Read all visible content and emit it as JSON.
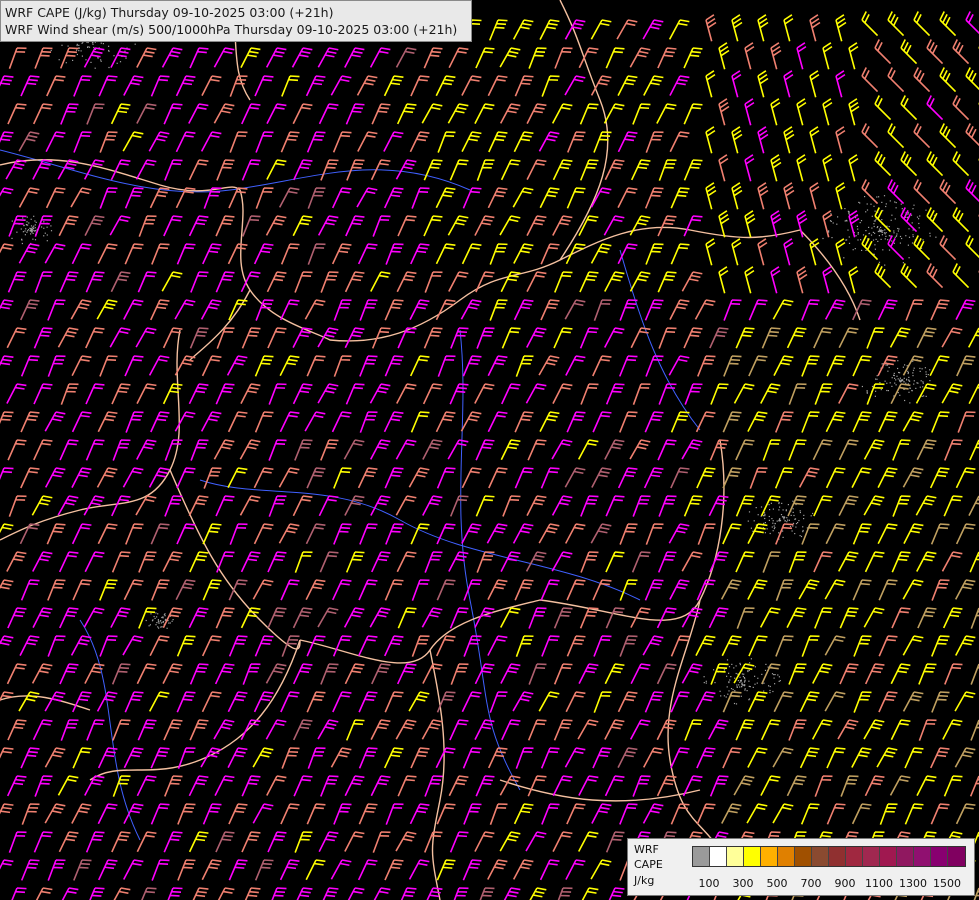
{
  "title": {
    "line1": "WRF CAPE (J/kg) Thursday 09-10-2025 03:00 (+21h)",
    "line2": "WRF Wind shear (m/s) 500/1000hPa Thursday 09-10-2025 03:00 (+21h)"
  },
  "legend": {
    "label1": "WRF",
    "label2": "CAPE",
    "label3": "J/kg",
    "ticks": [
      "100",
      "300",
      "500",
      "700",
      "900",
      "1100",
      "1300",
      "1500"
    ],
    "colors": [
      "#9a9a9a",
      "#ffffff",
      "#ffff99",
      "#ffff00",
      "#ffb000",
      "#e08000",
      "#a05000",
      "#8a4a30",
      "#903030",
      "#a02840",
      "#a02850",
      "#a01850",
      "#901860",
      "#901070",
      "#880070",
      "#800060"
    ]
  },
  "map": {
    "background": "#000000",
    "barb_colors": {
      "low": "#ff00ff",
      "mid": "#f08070",
      "high": "#ffff00",
      "brown": "#c0a060",
      "dark": "#b06070"
    },
    "border_color": "#f4c0a0",
    "river_color": "#4060ff",
    "cloud_color": "#a0a0a0"
  }
}
